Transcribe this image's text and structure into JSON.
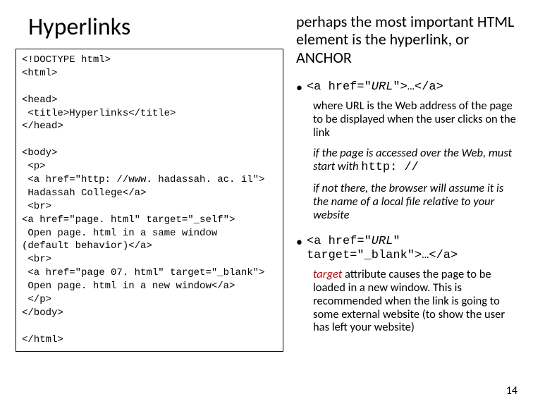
{
  "title": "Hyperlinks",
  "code": "<!DOCTYPE html>\n<html>\n\n<head>\n <title>Hyperlinks</title>\n</head>\n\n<body>\n <p>\n <a href=\"http: //www. hadassah. ac. il\">\n Hadassah College</a>\n <br>\n<a href=\"page. html\" target=\"_self\">\n Open page. html in a same window\n(default behavior)</a>\n <br>\n <a href=\"page 07. html\" target=\"_blank\">\n Open page. html in a new window</a>\n </p>\n</body>\n\n</html>",
  "intro": "perhaps the most important HTML element is the hyperlink, or ANCHOR",
  "bullet1": {
    "prefix": "<a href=\"",
    "mid": "URL",
    "suffix": "\">…</a>"
  },
  "sub1": "where URL is the Web address of the page to be displayed when the user clicks on the link",
  "sub2a": "if the page is accessed over the Web, must start with ",
  "sub2b": "http: //",
  "sub3": "if not there, the browser will assume it is the name of a local file relative to your website",
  "bullet2": {
    "prefix": "<a href=\"",
    "mid": "URL",
    "suffix1": "\"",
    "line2a": "target=\"_blank\">",
    "line2b": "…</a>"
  },
  "sub4a": "target",
  "sub4b": " attribute causes the page to be loaded in a new window. This is recommended when the link is going to some external website (to show the user has left your website)",
  "pagenum": "14"
}
